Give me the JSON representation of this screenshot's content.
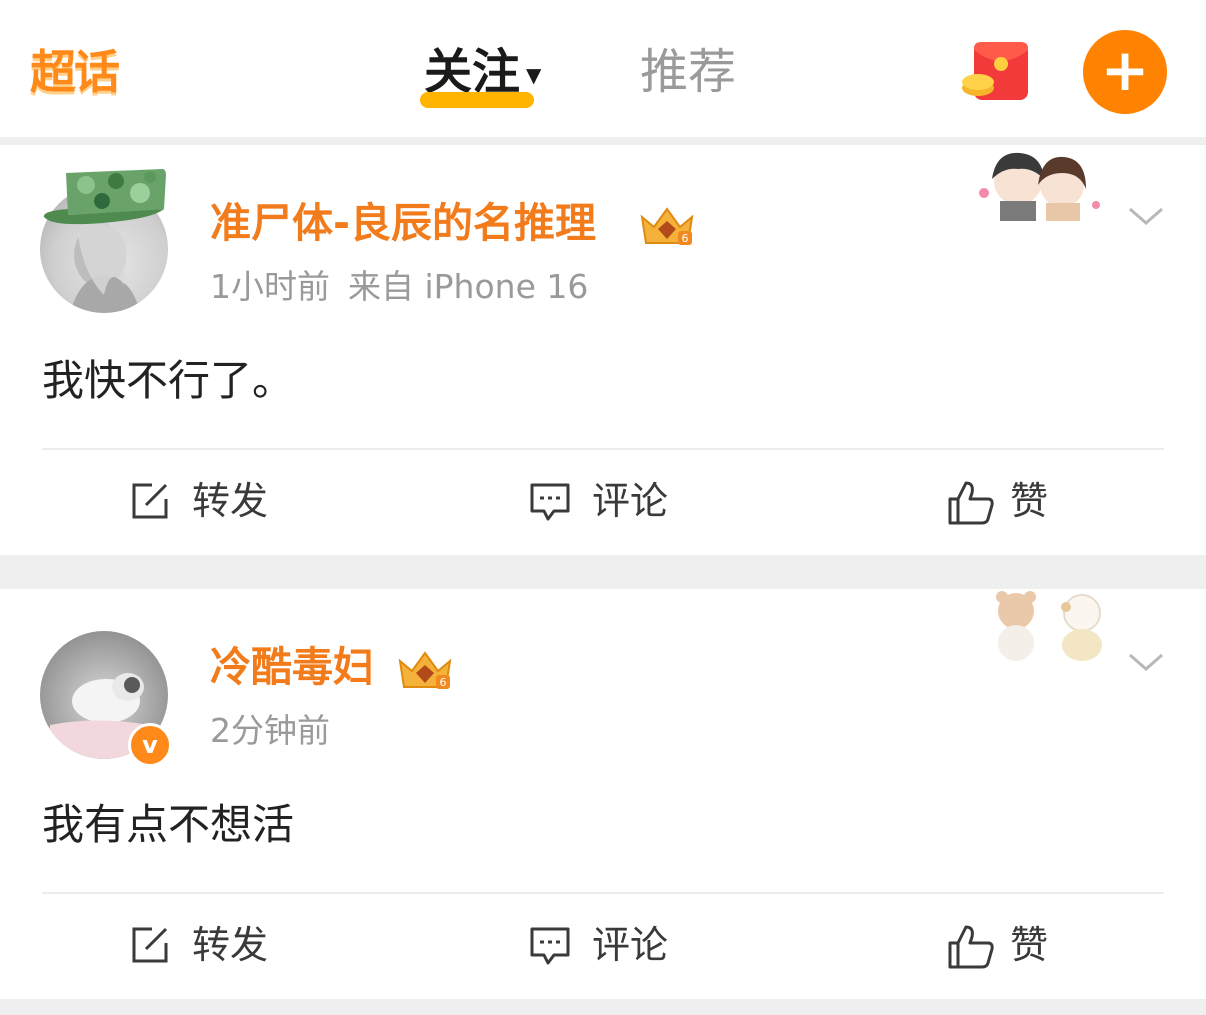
{
  "header": {
    "logo_text": "超话",
    "tabs": [
      {
        "label": "关注",
        "active": true
      },
      {
        "label": "推荐",
        "active": false
      }
    ],
    "add_label": "+"
  },
  "colors": {
    "accent": "#ff8200",
    "username": "#f27b1c",
    "tab_underline": "#ffb400",
    "muted": "#9a9a9a"
  },
  "posts": [
    {
      "username": "准尸体-良辰的名推理",
      "time": "1小时前",
      "source": "来自 iPhone 16",
      "content": "我快不行了。",
      "verified": false,
      "actions": {
        "repost": "转发",
        "comment": "评论",
        "like": "赞"
      }
    },
    {
      "username": "冷酷毒妇",
      "time": "2分钟前",
      "source": "",
      "content": "我有点不想活",
      "verified": true,
      "verified_mark": "v",
      "actions": {
        "repost": "转发",
        "comment": "评论",
        "like": "赞"
      }
    }
  ],
  "icons": {
    "redpacket": "red-envelope-icon",
    "add": "plus-icon",
    "more": "chevron-down-icon",
    "repost": "edit-share-icon",
    "comment": "comment-bubble-icon",
    "like": "thumbs-up-icon",
    "crown": "crown-badge-icon"
  }
}
